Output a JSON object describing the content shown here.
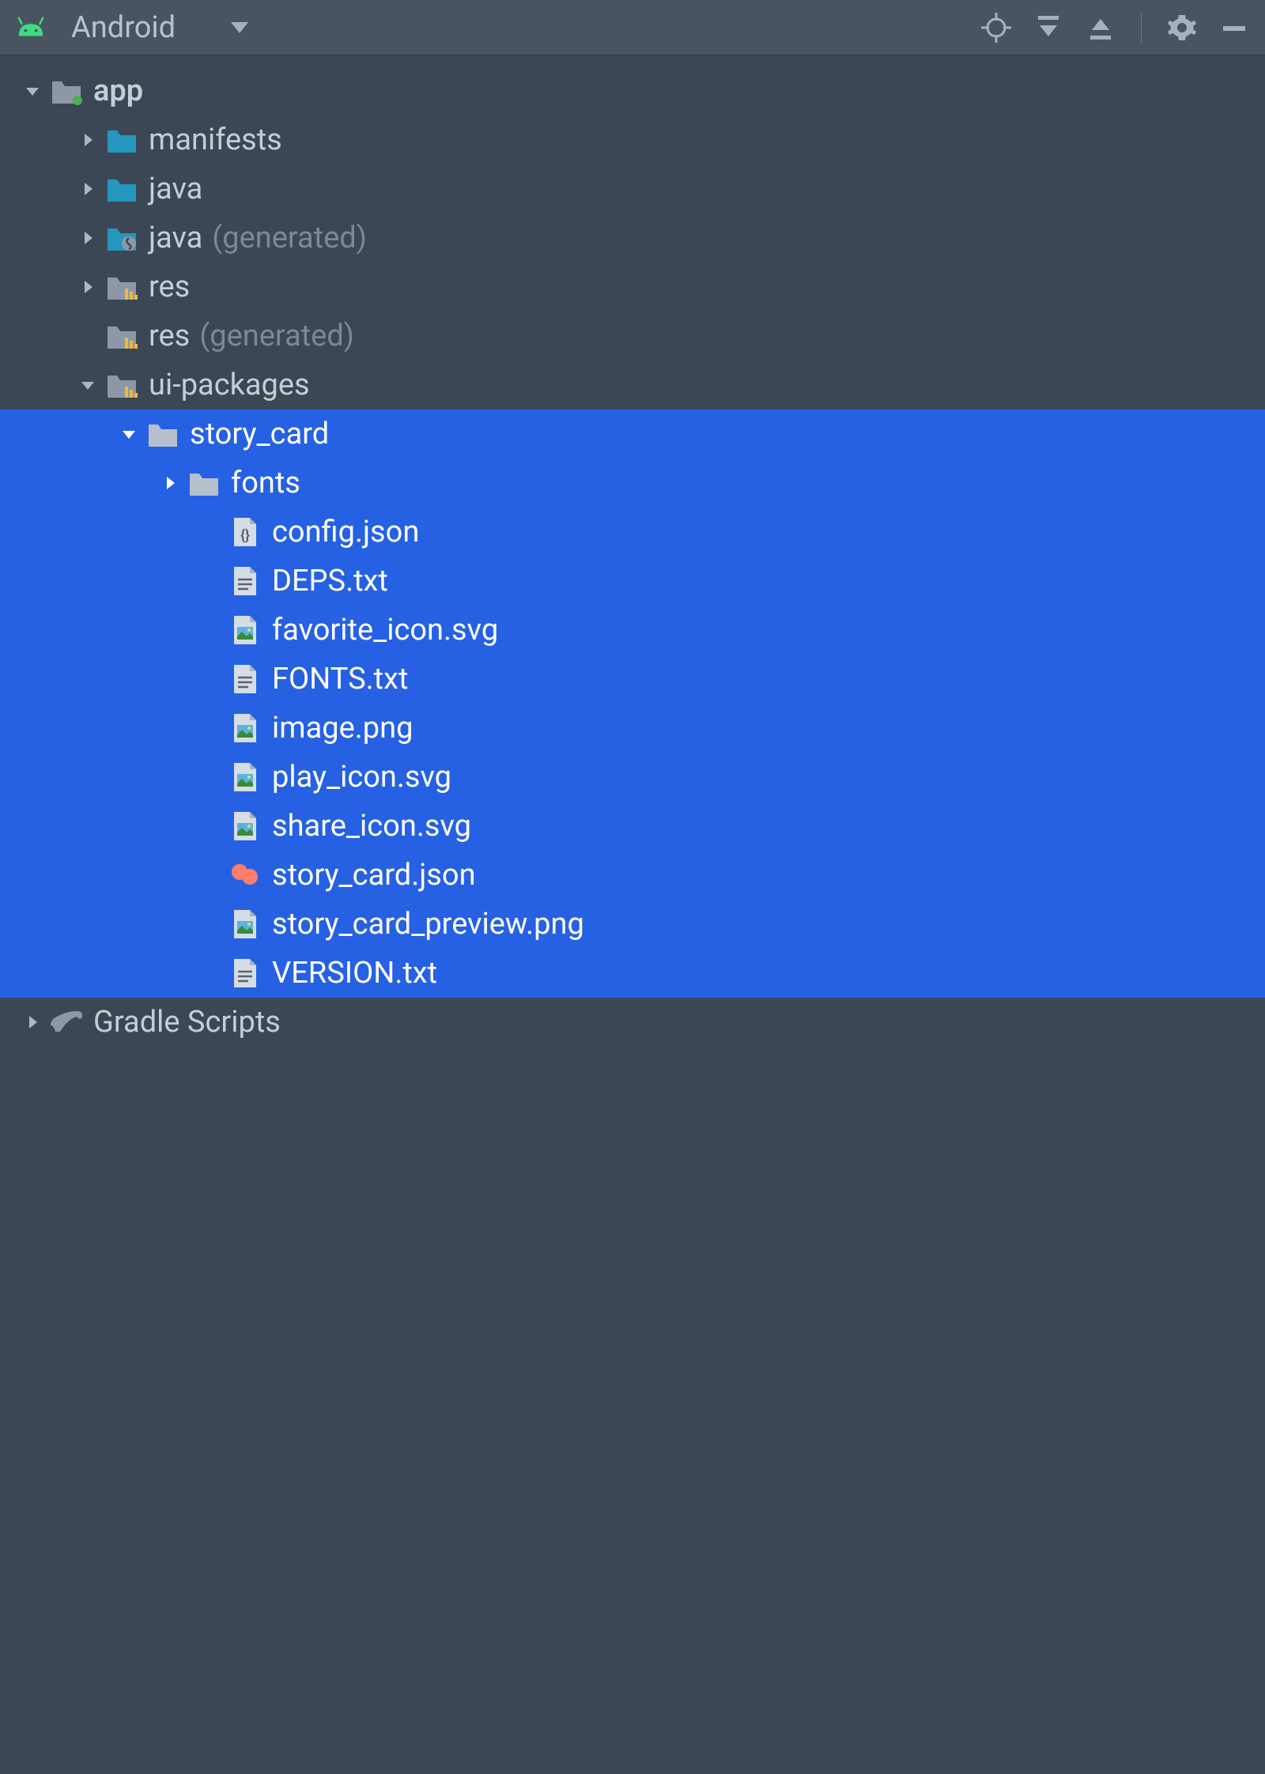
{
  "toolbar": {
    "viewName": "Android"
  },
  "tree": {
    "app": {
      "label": "app",
      "children": {
        "manifests": {
          "label": "manifests"
        },
        "java": {
          "label": "java"
        },
        "javaGen": {
          "label": "java",
          "suffix": "(generated)"
        },
        "res": {
          "label": "res"
        },
        "resGen": {
          "label": "res",
          "suffix": "(generated)"
        },
        "uiPackages": {
          "label": "ui-packages",
          "children": {
            "storyCard": {
              "label": "story_card",
              "children": {
                "fonts": {
                  "label": "fonts"
                },
                "configJson": {
                  "label": "config.json"
                },
                "depsTxt": {
                  "label": "DEPS.txt"
                },
                "favoriteIconSvg": {
                  "label": "favorite_icon.svg"
                },
                "fontsTxt": {
                  "label": "FONTS.txt"
                },
                "imagePng": {
                  "label": "image.png"
                },
                "playIconSvg": {
                  "label": "play_icon.svg"
                },
                "shareIconSvg": {
                  "label": "share_icon.svg"
                },
                "storyCardJson": {
                  "label": "story_card.json"
                },
                "storyCardPreviewPng": {
                  "label": "story_card_preview.png"
                },
                "versionTxt": {
                  "label": "VERSION.txt"
                }
              }
            }
          }
        }
      }
    },
    "gradle": {
      "label": "Gradle Scripts"
    }
  }
}
